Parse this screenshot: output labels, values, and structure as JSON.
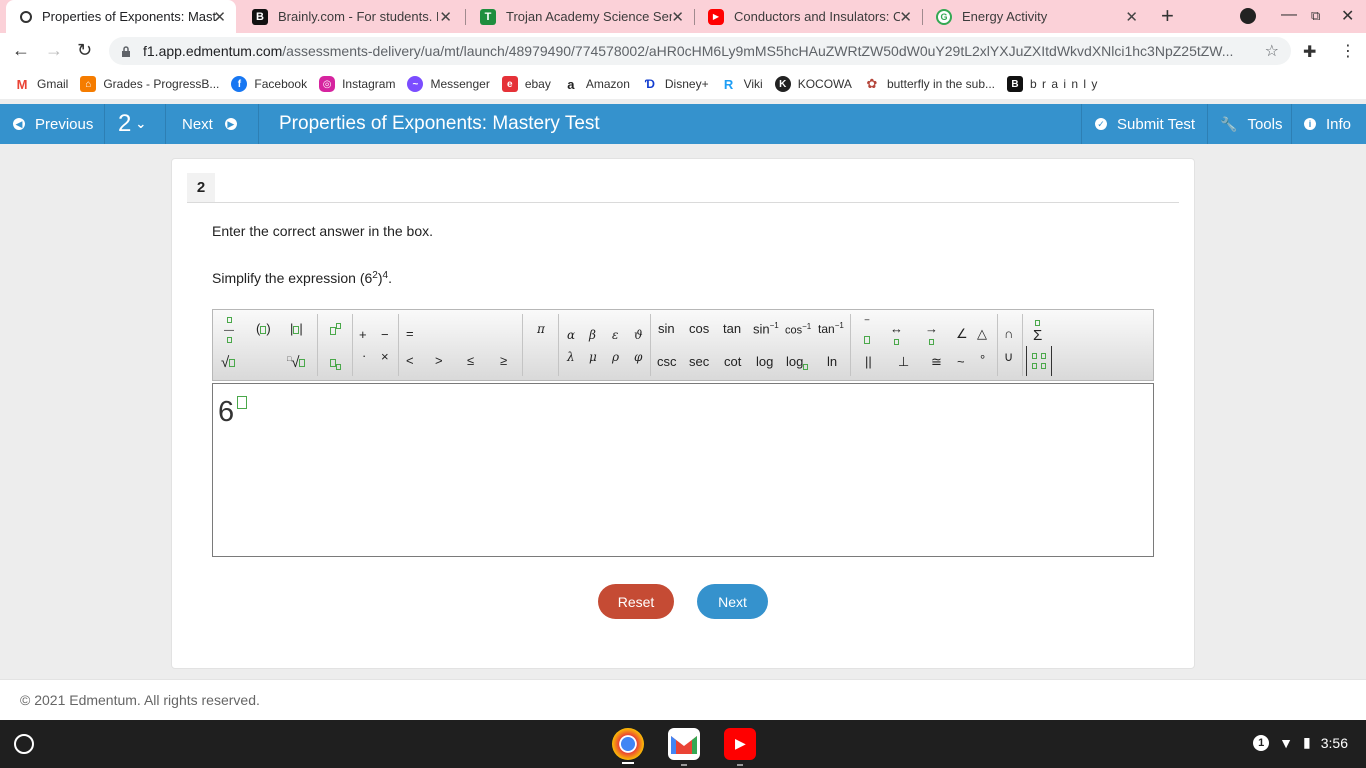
{
  "browser": {
    "tabs": [
      {
        "title": "Properties of Exponents: Mast",
        "favicon": "edmentum-icon",
        "color": "#ffffff"
      },
      {
        "title": "Brainly.com - For students. By",
        "favicon": "brainly-icon",
        "color": "#111111"
      },
      {
        "title": "Trojan Academy Science Seme",
        "favicon": "classroom-icon",
        "color": "#1e8e3e"
      },
      {
        "title": "Conductors and Insulators: Co",
        "favicon": "youtube-icon",
        "color": "#ff0000"
      },
      {
        "title": "Energy Activity",
        "favicon": "google-icon",
        "color": "#34a853"
      }
    ],
    "new_tab": "+",
    "url_host": "f1.app.edmentum.com",
    "url_path": "/assessments-delivery/ua/mt/launch/48979490/774578002/aHR0cHM6Ly9mMS5hcHAuZWRtZW50dW0uY29tL2xlYXJuZXItdWkvdXNlci1hc3NpZ25tZW...",
    "bookmarks": [
      {
        "label": "Gmail",
        "icon": "gmail-icon",
        "color": "#ea4335"
      },
      {
        "label": "Grades - ProgressB...",
        "icon": "grades-icon",
        "color": "#f57c00"
      },
      {
        "label": "Facebook",
        "icon": "facebook-icon",
        "color": "#1877f2"
      },
      {
        "label": "Instagram",
        "icon": "instagram-icon",
        "color": "#d6249f"
      },
      {
        "label": "Messenger",
        "icon": "messenger-icon",
        "color": "#7b4dff"
      },
      {
        "label": "ebay",
        "icon": "ebay-icon",
        "color": "#e53238"
      },
      {
        "label": "Amazon",
        "icon": "amazon-icon",
        "color": "#222222"
      },
      {
        "label": "Disney+",
        "icon": "disney-icon",
        "color": "#113ccf"
      },
      {
        "label": "Viki",
        "icon": "viki-icon",
        "color": "#1e9ef5"
      },
      {
        "label": "KOCOWA",
        "icon": "kocowa-icon",
        "color": "#222222"
      },
      {
        "label": "butterfly in the sub...",
        "icon": "butterfly-icon",
        "color": "#b5463b"
      },
      {
        "label": "b r a i n l y",
        "icon": "brainly-icon",
        "color": "#111111"
      }
    ]
  },
  "app": {
    "previous_label": "Previous",
    "question_select": "2",
    "next_label": "Next",
    "title": "Properties of Exponents: Mastery Test",
    "submit_label": "Submit Test",
    "tools_label": "Tools",
    "info_label": "Info",
    "brand_color": "#3592cd"
  },
  "question": {
    "number": "2",
    "instruction": "Enter the correct answer in the box.",
    "prompt_prefix": "Simplify the expression (6",
    "prompt_exp_inner": "2",
    "prompt_mid": ")",
    "prompt_exp_outer": "4",
    "prompt_end": "."
  },
  "palette": {
    "ops": [
      "+",
      "−",
      "·",
      "×",
      "=",
      "<",
      ">",
      "≤",
      "≥"
    ],
    "pi": "π",
    "greek": [
      "α",
      "β",
      "ε",
      "ϑ",
      "λ",
      "μ",
      "ρ",
      "φ"
    ],
    "trig_top": [
      "sin",
      "cos",
      "tan",
      "sin",
      "cos",
      "tan"
    ],
    "inv_exp": "−1",
    "trig_bottom": [
      "csc",
      "sec",
      "cot",
      "log",
      "log",
      "ln"
    ],
    "geom_top": [
      "↔",
      "→",
      "∠",
      "△"
    ],
    "geom_bottom": [
      "||",
      "⊥",
      "≅",
      "~",
      "°"
    ],
    "sets": [
      "∩",
      "∪"
    ],
    "sum": "Σ"
  },
  "answer": {
    "base": "6"
  },
  "buttons": {
    "reset_label": "Reset",
    "reset_color": "#c54b34",
    "next_label": "Next",
    "next_color": "#3592cd"
  },
  "footer": {
    "copyright": "© 2021 Edmentum. All rights reserved."
  },
  "system": {
    "notification_count": "1",
    "time": "3:56"
  }
}
